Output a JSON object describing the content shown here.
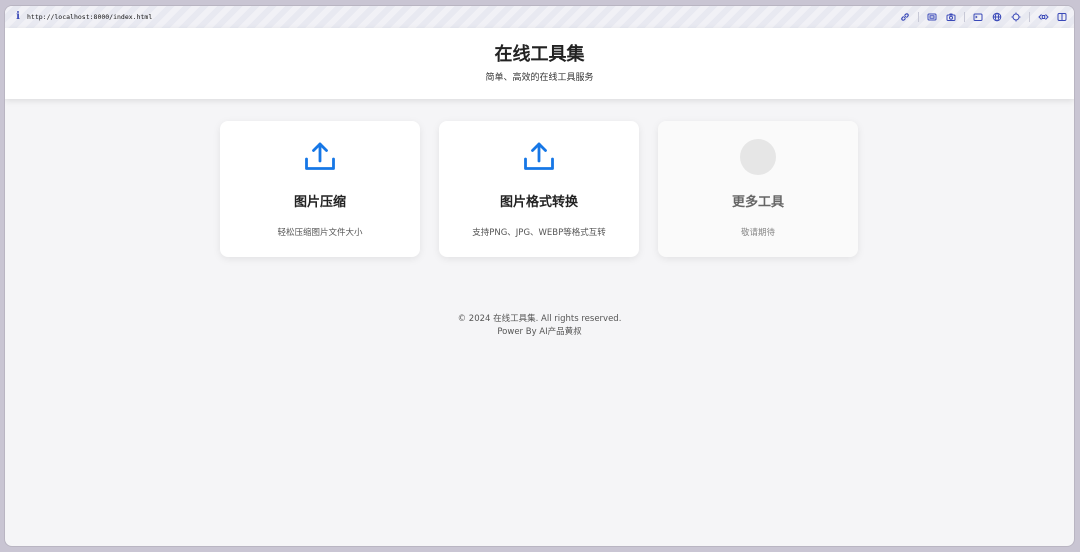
{
  "browser": {
    "url": "http://localhost:8000/index.html",
    "info_icon": "i",
    "toolbar_icons": [
      "link-icon",
      "screenshot-icon",
      "camera-icon",
      "terminal-icon",
      "globe-icon",
      "crosshair-icon",
      "code-icon",
      "sidebar-icon"
    ]
  },
  "header": {
    "title": "在线工具集",
    "subtitle": "简单、高效的在线工具服务"
  },
  "tools": [
    {
      "icon": "upload-icon",
      "title": "图片压缩",
      "description": "轻松压缩图片文件大小"
    },
    {
      "icon": "upload-icon",
      "title": "图片格式转换",
      "description": "支持PNG、JPG、WEBP等格式互转"
    },
    {
      "icon": "placeholder-circle",
      "title": "更多工具",
      "description": "敬请期待"
    }
  ],
  "footer": {
    "copyright": "© 2024 在线工具集. All rights reserved.",
    "credit": "Power By AI产品黄叔"
  },
  "colors": {
    "accent": "#1677e6",
    "toolbar_icon": "#3a49b8",
    "page_bg": "#f5f5f7"
  }
}
